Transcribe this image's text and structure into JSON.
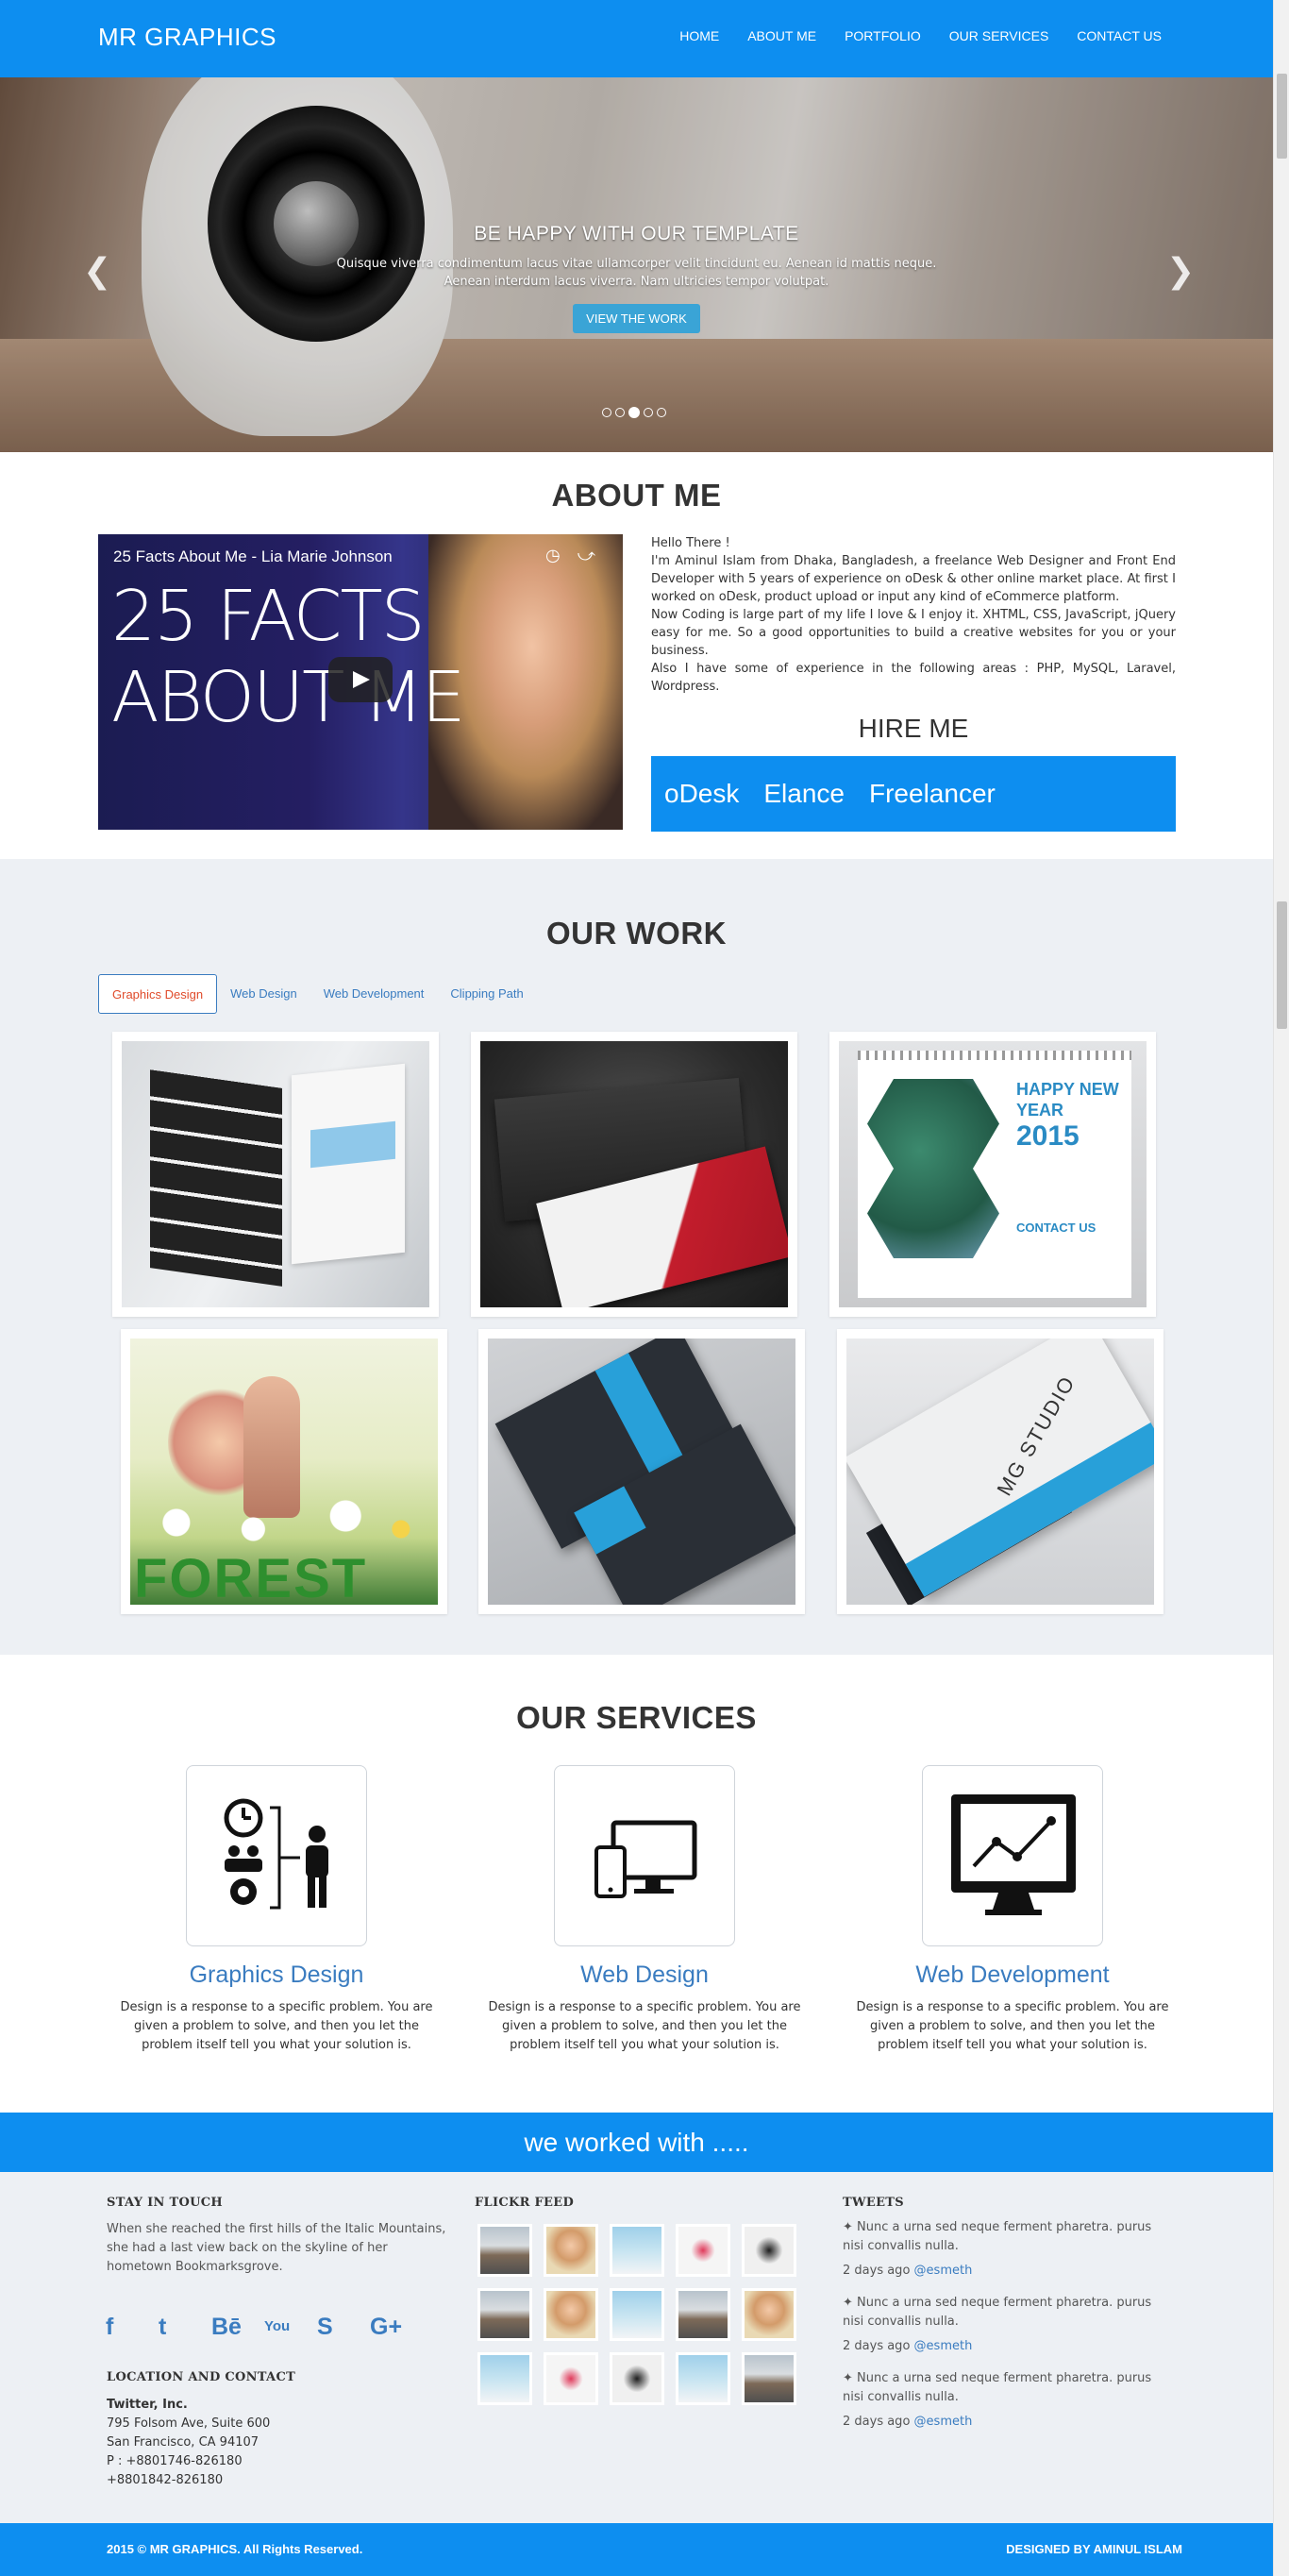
{
  "brand": "MR GRAPHICS",
  "nav": [
    "HOME",
    "ABOUT ME",
    "PORTFOLIO",
    "OUR SERVICES",
    "CONTACT US"
  ],
  "hero": {
    "title": "BE HAPPY WITH OUR TEMPLATE",
    "text_line1": "Quisque viverra condimentum lacus vitae ullamcorper velit tincidunt eu. Aenean id mattis neque.",
    "text_line2": "Aenean interdum lacus viverra. Nam ultricies tempor volutpat.",
    "button": "VIEW THE WORK",
    "prev_icon": "chevron-left-icon",
    "next_icon": "chevron-right-icon",
    "slide_count": 5,
    "active_slide": 3
  },
  "about": {
    "title": "ABOUT ME",
    "video_title": "25 Facts About Me - Lia Marie Johnson",
    "video_big_text_line1": "25 FACTS",
    "video_big_text_line2": "ABOUT ME",
    "greeting": "Hello There !",
    "p1": "I'm Aminul Islam from Dhaka, Bangladesh, a freelance Web Designer and Front End Developer with 5 years of experience on oDesk & other online market place. At first I worked on oDesk, product upload or input any kind of eCommerce platform.",
    "p2": "Now Coding is large part of my life I love & I enjoy it. XHTML, CSS, JavaScript, jQuery easy for me. So a good opportunities to build a creative websites for you or your business.",
    "p3": "Also I have some of experience in the following areas : PHP, MySQL, Laravel, Wordpress.",
    "hire_title": "HIRE ME",
    "hire_links": [
      "oDesk",
      "Elance",
      "Freelancer"
    ]
  },
  "work": {
    "title": "OUR WORK",
    "tabs": [
      "Graphics Design",
      "Web Design",
      "Web Development",
      "Clipping Path"
    ],
    "active_tab": 0,
    "thumb_text": {
      "calendar_line1": "HAPPY NEW YEAR",
      "calendar_year": "2015",
      "calendar_contact": "CONTACT US",
      "flyer": "FOREST",
      "card": "MG STUDIO"
    }
  },
  "services": {
    "title": "OUR SERVICES",
    "items": [
      {
        "name": "Graphics Design",
        "icon": "team-structure-icon",
        "desc": "Design is a response to a specific problem. You are given a problem to solve, and then you let the problem itself tell you what your solution is."
      },
      {
        "name": "Web Design",
        "icon": "responsive-devices-icon",
        "desc": "Design is a response to a specific problem. You are given a problem to solve, and then you let the problem itself tell you what your solution is."
      },
      {
        "name": "Web Development",
        "icon": "monitor-chart-icon",
        "desc": "Design is a response to a specific problem. You are given a problem to solve, and then you let the problem itself tell you what your solution is."
      }
    ]
  },
  "worked_with": "we worked with .....",
  "footer": {
    "stay_title": "STAY IN TOUCH",
    "stay_text": "When she reached the first hills of the Italic Mountains, she had a last view back on the skyline of her hometown Bookmarksgrove.",
    "socials": [
      "facebook-icon",
      "twitter-icon",
      "behance-icon",
      "youtube-icon",
      "skype-icon",
      "google-plus-icon"
    ],
    "social_glyphs": [
      "f",
      "t",
      "Bē",
      "You",
      "S",
      "G+"
    ],
    "location_title": "LOCATION AND CONTACT",
    "company": "Twitter, Inc.",
    "address1": "795 Folsom Ave, Suite 600",
    "address2": "San Francisco, CA 94107",
    "phone1": "P : +8801746-826180",
    "phone2": "+8801842-826180",
    "flickr_title": "FLICKR FEED",
    "tweets_title": "TWEETS",
    "tweets": [
      {
        "text": "Nunc a urna sed neque ferment pharetra. purus nisi convallis nulla.",
        "when": "2 days ago",
        "handle": "@esmeth"
      },
      {
        "text": "Nunc a urna sed neque ferment pharetra. purus nisi convallis nulla.",
        "when": "2 days ago",
        "handle": "@esmeth"
      },
      {
        "text": "Nunc a urna sed neque ferment pharetra. purus nisi convallis nulla.",
        "when": "2 days ago",
        "handle": "@esmeth"
      }
    ],
    "copyright": "2015 © MR GRAPHICS. All Rights Reserved.",
    "designed_by": "DESIGNED BY AMINUL ISLAM"
  },
  "colors": {
    "accent": "#0d8ef0",
    "link": "#3a7cc0",
    "section_bg": "#edf0f4",
    "active_tab": "#e04b2b"
  }
}
